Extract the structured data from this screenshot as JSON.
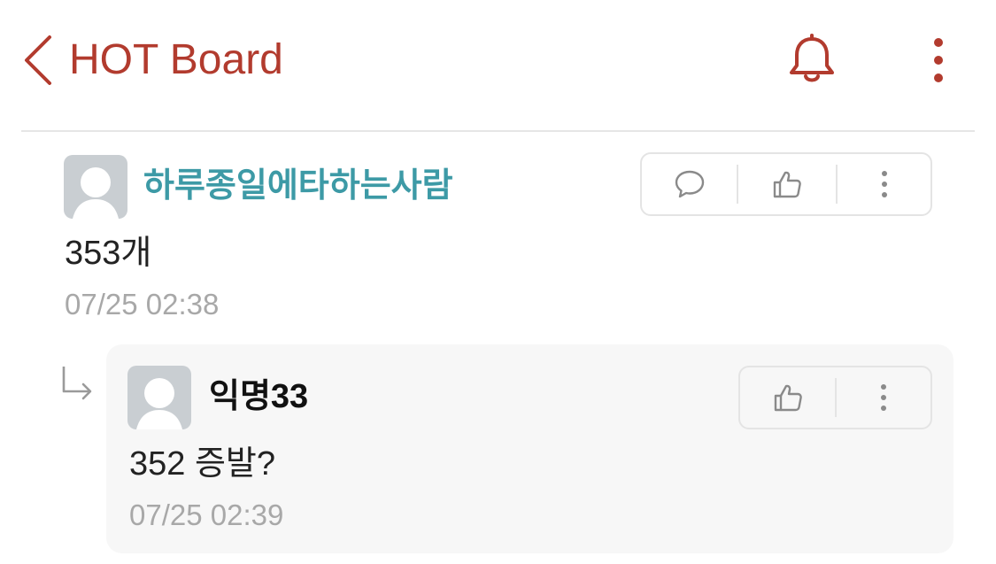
{
  "header": {
    "title": "HOT Board",
    "back_icon": "chevron-left-icon",
    "bell_icon": "bell-icon",
    "more_icon": "more-vertical-icon",
    "accent_color": "#b23b2e"
  },
  "comment": {
    "author": "하루종일에타하는사람",
    "author_color": "#3d9aa6",
    "body": "353개",
    "timestamp": "07/25 02:38",
    "actions": [
      "speech-bubble-icon",
      "thumbs-up-icon",
      "more-vertical-icon"
    ]
  },
  "reply": {
    "author": "익명33",
    "body": "352 증발?",
    "timestamp": "07/25 02:39",
    "actions": [
      "thumbs-up-icon",
      "more-vertical-icon"
    ]
  }
}
